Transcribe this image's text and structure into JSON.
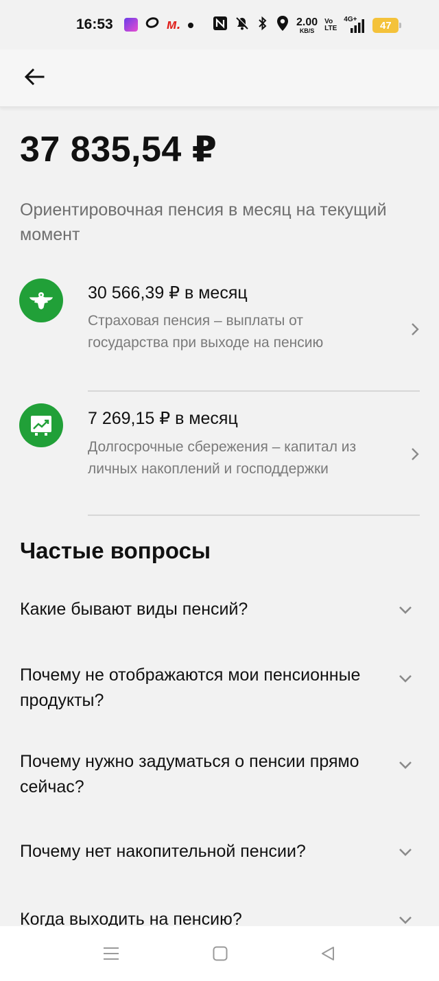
{
  "status_bar": {
    "time": "16:53",
    "net_speed_value": "2.00",
    "net_speed_unit": "KB/S",
    "volte_top": "Vo",
    "volte_bottom": "LTE",
    "network": "4G+",
    "battery": "47",
    "icons": [
      "game-app-icon",
      "ring-app-icon",
      "m-app-icon",
      "dot-icon",
      "nfc-icon",
      "mute-bell-icon",
      "bluetooth-icon",
      "location-icon",
      "signal-icon",
      "battery-icon"
    ]
  },
  "header": {
    "back_icon": "arrow-left-icon"
  },
  "summary": {
    "amount": "37 835,54 ₽",
    "caption": "Ориентировочная пенсия в месяц на текущий момент"
  },
  "pensions": [
    {
      "icon": "eagle-emblem-icon",
      "amount": "30 566,39 ₽ в месяц",
      "description": "Страховая пенсия – выплаты от государства при выходе на пенсию"
    },
    {
      "icon": "growth-chart-icon",
      "amount": "7 269,15 ₽ в месяц",
      "description": "Долгосрочные сбережения – капитал из личных накоплений и господдержки"
    }
  ],
  "faq": {
    "title": "Частые вопросы",
    "items": [
      "Какие бывают виды пенсий?",
      "Почему не отображаются мои пенсионные продукты?",
      "Почему нужно задуматься о пенсии прямо сейчас?",
      "Почему нет накопительной пенсии?",
      "Когда выходить на пенсию?"
    ]
  },
  "colors": {
    "brand_green": "#21a038",
    "text_primary": "#111111",
    "text_secondary": "#7a7a7a",
    "background": "#f2f2f2"
  },
  "nav_bar": {
    "icons": [
      "menu-icon",
      "home-square-icon",
      "back-triangle-icon"
    ]
  }
}
